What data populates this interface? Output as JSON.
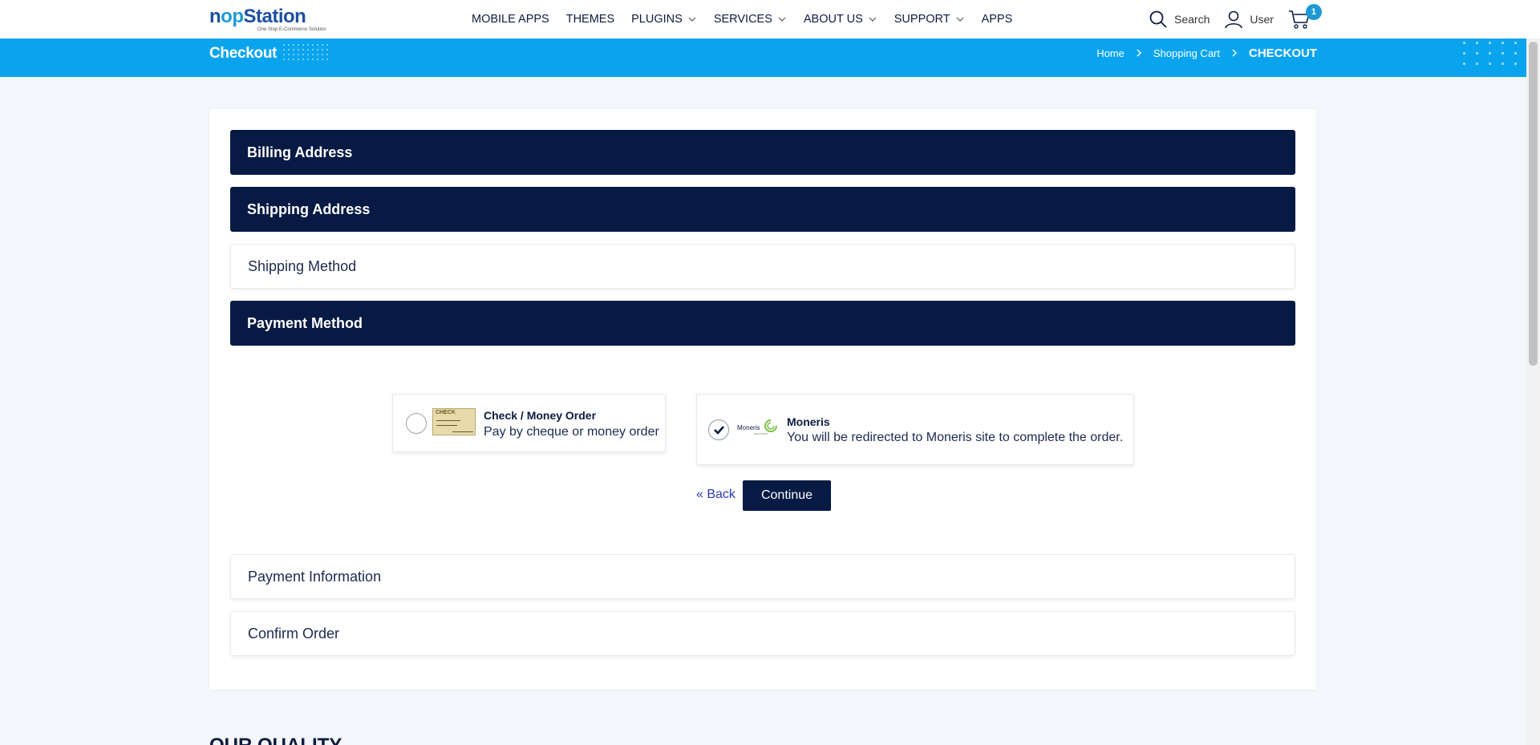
{
  "header": {
    "logo_text_pre": "n",
    "logo_text_op": "op",
    "logo_text_post": "Station",
    "logo_tagline": "One Stop E-Commerce Solution",
    "nav": [
      {
        "label": "MOBILE APPS",
        "dropdown": false
      },
      {
        "label": "THEMES",
        "dropdown": false
      },
      {
        "label": "PLUGINS",
        "dropdown": true
      },
      {
        "label": "SERVICES",
        "dropdown": true
      },
      {
        "label": "ABOUT US",
        "dropdown": true
      },
      {
        "label": "SUPPORT",
        "dropdown": true
      },
      {
        "label": "APPS",
        "dropdown": false
      }
    ],
    "search_label": "Search",
    "user_label": "User",
    "cart_count": "1"
  },
  "banner": {
    "title": "Checkout",
    "breadcrumb": {
      "home": "Home",
      "cart": "Shopping Cart",
      "current": "CHECKOUT"
    }
  },
  "checkout": {
    "steps": {
      "billing": "Billing Address",
      "shipping_address": "Shipping Address",
      "shipping_method": "Shipping Method",
      "payment_method": "Payment Method",
      "payment_info": "Payment Information",
      "confirm": "Confirm Order"
    },
    "payment_methods": {
      "check": {
        "title": "Check / Money Order",
        "description": "Pay by cheque or money order",
        "image_text": "CHECK",
        "selected": false
      },
      "moneris": {
        "title": "Moneris",
        "description": "You will be redirected to Moneris site to complete the order.",
        "logo_text": "Moneris",
        "logo_sub": "SOLUTIONS",
        "selected": true
      }
    },
    "back_label": "« Back",
    "continue_label": "Continue"
  },
  "footer_peek": {
    "heading": "OUR QUALITY"
  },
  "colors": {
    "banner": "#0aa4ee",
    "step_active": "#061a44",
    "brand_blue": "#1c4fa0",
    "accent": "#1c9ad6"
  }
}
